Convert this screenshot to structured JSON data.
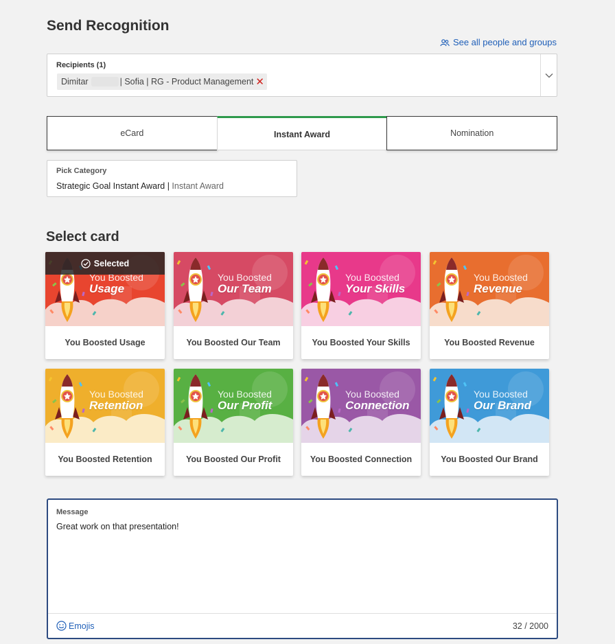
{
  "page": {
    "title": "Send Recognition"
  },
  "see_all": {
    "label": "See all people and groups",
    "icon": "people-icon",
    "color": "#1f5fb8"
  },
  "recipients": {
    "label": "Recipients (1)",
    "chip_first_name": "Dimitar",
    "chip_details": "| Sofia | RG - Product Management",
    "remove_glyph": "✕"
  },
  "tabs": [
    {
      "label": "eCard",
      "active": false
    },
    {
      "label": "Instant Award",
      "active": true
    },
    {
      "label": "Nomination",
      "active": false
    }
  ],
  "category": {
    "label": "Pick Category",
    "value": "Strategic Goal Instant Award",
    "separator": "|",
    "subvalue": "Instant Award"
  },
  "select_card": {
    "title": "Select card",
    "selected_label": "Selected",
    "cards": [
      {
        "title": "You Boosted Usage",
        "art_line1": "You Boosted",
        "art_line2": "Usage",
        "color": "#e8452f",
        "cloud": "#f6d1c9",
        "selected": true
      },
      {
        "title": "You Boosted Our Team",
        "art_line1": "You Boosted",
        "art_line2": "Our Team",
        "color": "#d64a64",
        "cloud": "#f3d0d6",
        "selected": false
      },
      {
        "title": "You Boosted Your Skills",
        "art_line1": "You Boosted",
        "art_line2": "Your Skills",
        "color": "#e8398a",
        "cloud": "#f8cfe2",
        "selected": false
      },
      {
        "title": "You Boosted Revenue",
        "art_line1": "You Boosted",
        "art_line2": "Revenue",
        "color": "#e86e2f",
        "cloud": "#f7dccb",
        "selected": false
      },
      {
        "title": "You Boosted Retention",
        "art_line1": "You Boosted",
        "art_line2": "Retention",
        "color": "#efaf2c",
        "cloud": "#fbebc6",
        "selected": false
      },
      {
        "title": "You Boosted Our Profit",
        "art_line1": "You Boosted",
        "art_line2": "Our Profit",
        "color": "#58b043",
        "cloud": "#d6ecce",
        "selected": false
      },
      {
        "title": "You Boosted Connection",
        "art_line1": "You Boosted",
        "art_line2": "Connection",
        "color": "#9a58a6",
        "cloud": "#e5d4e8",
        "selected": false
      },
      {
        "title": "You Boosted Our Brand",
        "art_line1": "You Boosted",
        "art_line2": "Our Brand",
        "color": "#3f9ad8",
        "cloud": "#d2e6f5",
        "selected": false
      }
    ]
  },
  "message": {
    "label": "Message",
    "value": "Great work on that presentation!",
    "emojis_label": "Emojis",
    "counter": "32 / 2000"
  }
}
